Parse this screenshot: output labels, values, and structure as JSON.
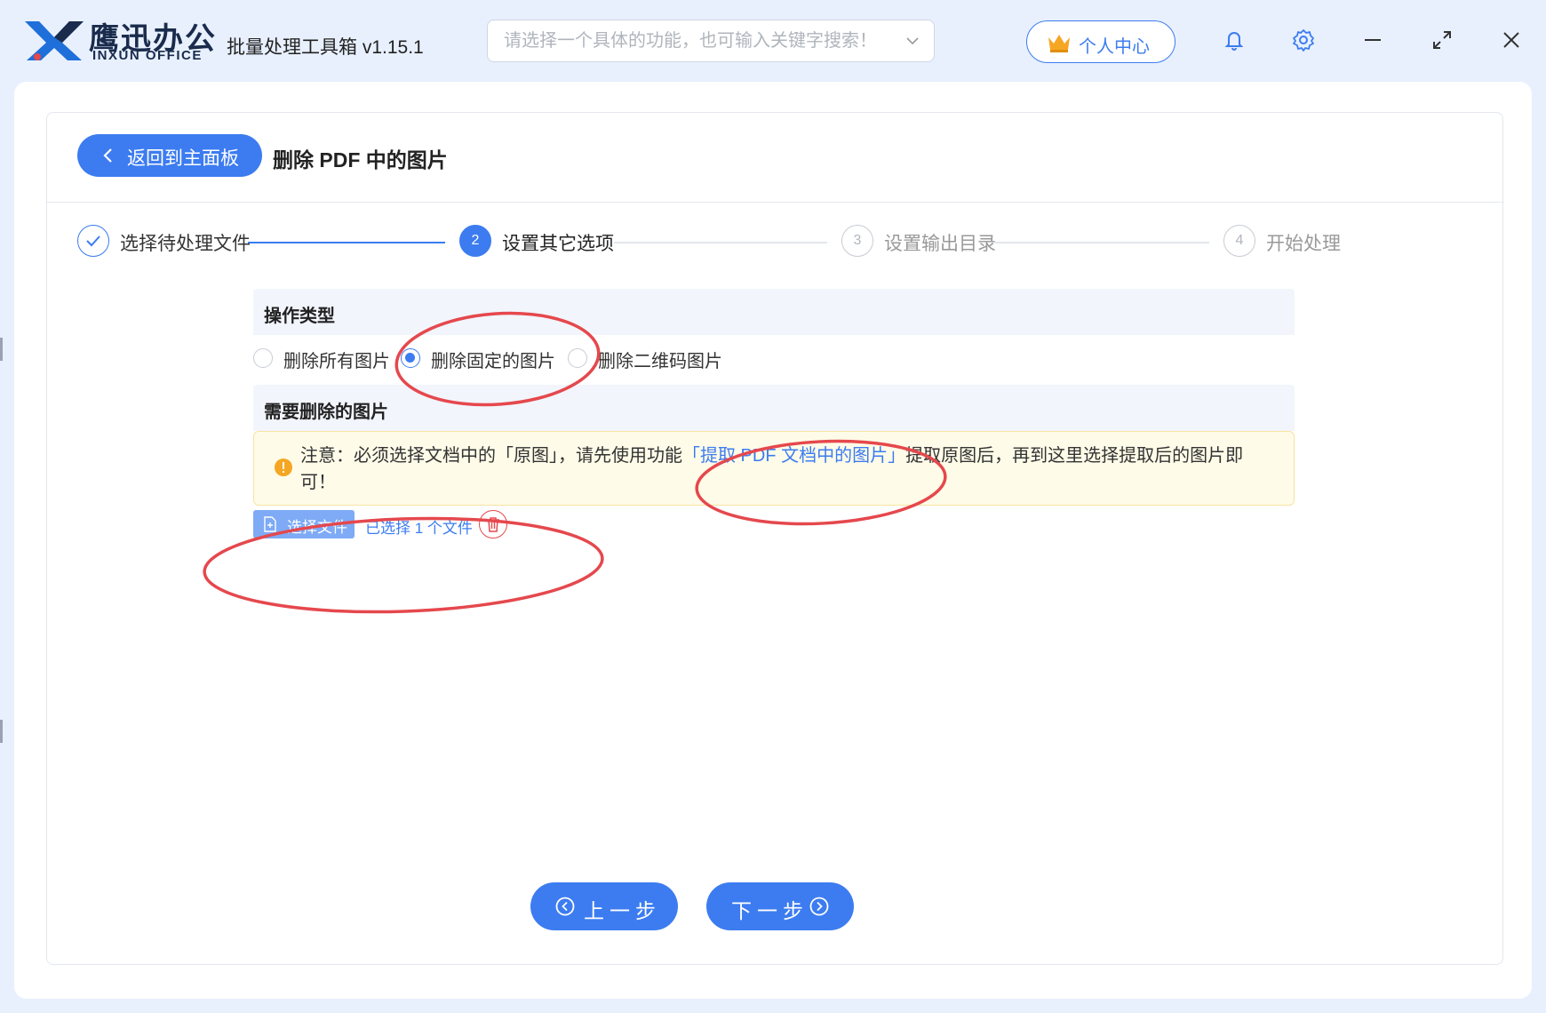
{
  "app": {
    "brand_cn": "鹰迅办公",
    "brand_en": "INXUN OFFICE",
    "title": "批量处理工具箱 v1.15.1",
    "search_placeholder": "请选择一个具体的功能，也可输入关键字搜索！",
    "user_center": "个人中心",
    "accent": "#3c7cf0"
  },
  "toolbar_icons": [
    "bell-icon",
    "gear-icon",
    "minimize-icon",
    "maximize-icon",
    "close-icon"
  ],
  "header": {
    "back_label": "返回到主面板",
    "page_title": "删除 PDF 中的图片"
  },
  "steps": [
    {
      "number": "",
      "label": "选择待处理文件",
      "state": "done"
    },
    {
      "number": "2",
      "label": "设置其它选项",
      "state": "active"
    },
    {
      "number": "3",
      "label": "设置输出目录",
      "state": "pending"
    },
    {
      "number": "4",
      "label": "开始处理",
      "state": "pending"
    }
  ],
  "operation": {
    "section_label": "操作类型",
    "options": [
      {
        "label": "删除所有图片",
        "selected": false
      },
      {
        "label": "删除固定的图片",
        "selected": true
      },
      {
        "label": "删除二维码图片",
        "selected": false
      }
    ]
  },
  "images": {
    "section_label": "需要删除的图片",
    "notice_before": "注意：必须选择文档中的「原图」，请先使用功能",
    "notice_link": "「提取 PDF 文档中的图片」",
    "notice_after": "提取原图后，再到这里选择提取后的图片即可！",
    "select_button": "选择文件",
    "selected_count": "已选择 1 个文件"
  },
  "footer": {
    "prev": "上一步",
    "next": "下一步"
  },
  "annotation_color": "#e5484d"
}
